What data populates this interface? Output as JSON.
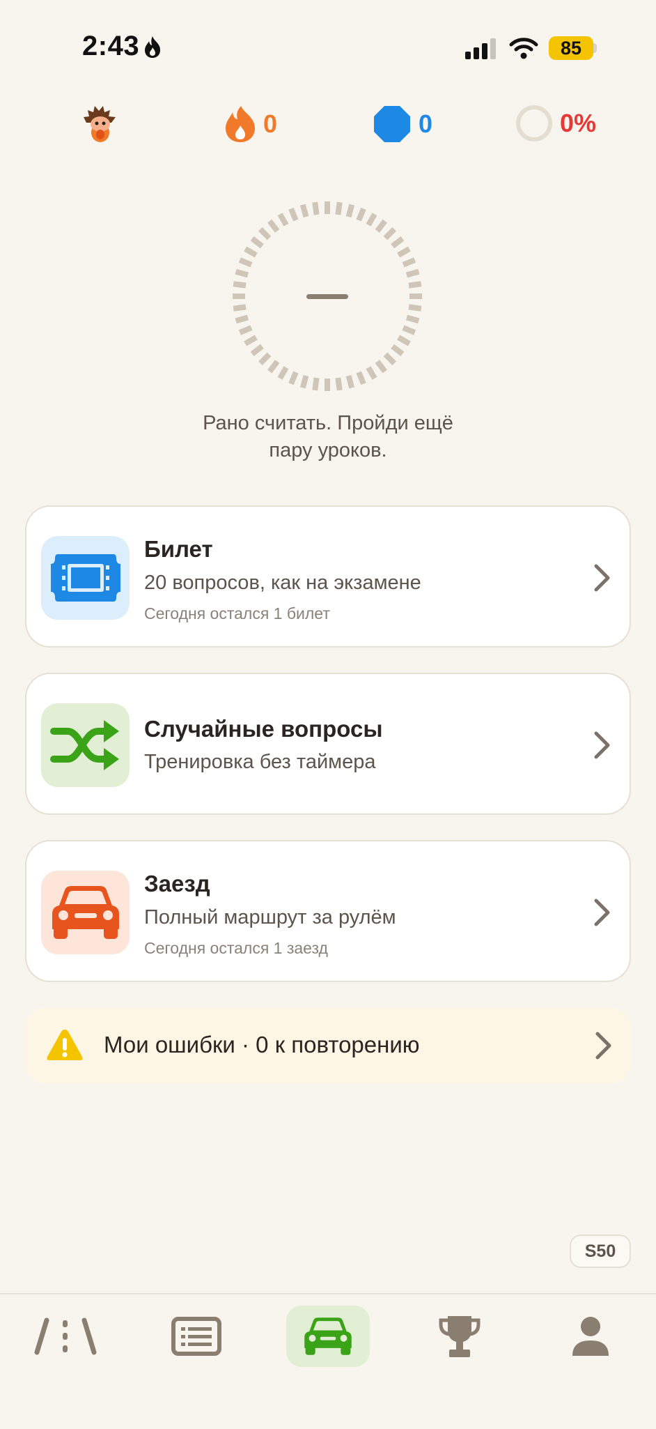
{
  "status_bar": {
    "time": "2:43",
    "battery": "85"
  },
  "stats": {
    "streak": "0",
    "gems": "0",
    "progress": "0%"
  },
  "gauge": {
    "value": "—",
    "message_line1": "Рано считать. Пройди ещё",
    "message_line2": "пару уроков."
  },
  "cards": [
    {
      "title": "Билет",
      "subtitle": "20 вопросов, как на экзамене",
      "note": "Сегодня остался 1 билет"
    },
    {
      "title": "Случайные вопросы",
      "subtitle": "Тренировка без таймера"
    },
    {
      "title": "Заезд",
      "subtitle": "Полный маршрут за рулём",
      "note": "Сегодня остался 1 заезд"
    }
  ],
  "mistakes": {
    "label": "Мои ошибки · 0 к повторению"
  },
  "version": "S50",
  "tabs": [
    {
      "icon": "road-icon",
      "active": false
    },
    {
      "icon": "list-icon",
      "active": false
    },
    {
      "icon": "car-icon",
      "active": true
    },
    {
      "icon": "trophy-icon",
      "active": false
    },
    {
      "icon": "profile-icon",
      "active": false
    }
  ],
  "colors": {
    "background": "#f8f5ef",
    "orange": "#f07a2a",
    "blue": "#1e88e5",
    "red": "#e53935",
    "green": "#3aa318",
    "active_tab_bg": "#e2efd4",
    "warning_bg": "#fdf6e4"
  }
}
